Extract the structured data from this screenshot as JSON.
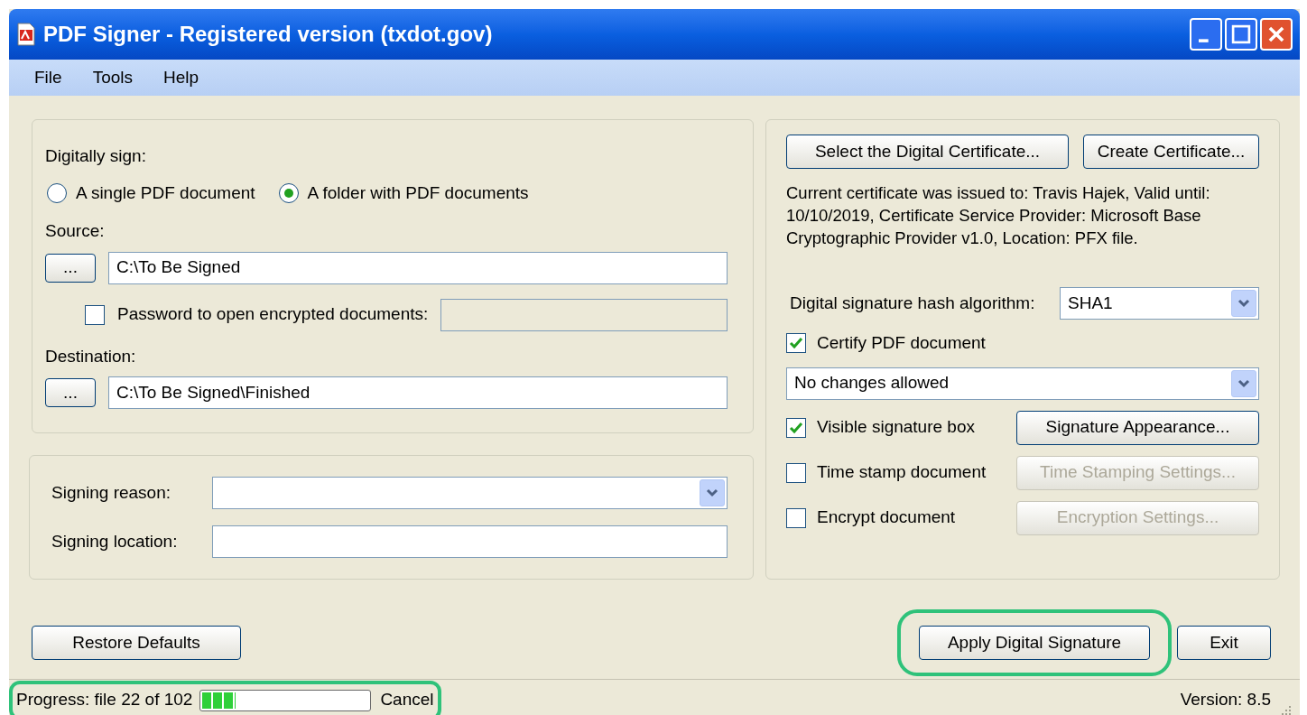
{
  "window": {
    "title": "PDF Signer - Registered version (txdot.gov)"
  },
  "menu": [
    "File",
    "Tools",
    "Help"
  ],
  "sign_panel": {
    "label": "Digitally sign:",
    "modes": [
      {
        "label": "A single PDF document",
        "selected": false
      },
      {
        "label": "A folder with PDF documents",
        "selected": true
      }
    ],
    "source": {
      "label": "Source:",
      "browse": "...",
      "value": "C:\\To Be Signed"
    },
    "password": {
      "label": "Password to open encrypted documents:",
      "checked": false,
      "disabled": true
    },
    "destination": {
      "label": "Destination:",
      "browse": "...",
      "value": "C:\\To Be Signed\\Finished"
    }
  },
  "reason_panel": {
    "reason": {
      "label": "Signing reason:"
    },
    "location": {
      "label": "Signing location:"
    }
  },
  "cert_panel": {
    "buttons": [
      "Select the Digital Certificate...",
      "Create Certificate..."
    ],
    "info": "Current certificate was issued to: Travis Hajek, Valid until: 10/10/2019, Certificate Service Provider: Microsoft Base Cryptographic Provider v1.0, Location: PFX file.",
    "hash": {
      "label": "Digital signature hash algorithm:",
      "value": "SHA1"
    },
    "options": [
      {
        "kind": "checkbox",
        "label": "Certify PDF document",
        "checked": true
      },
      {
        "kind": "dropdown",
        "value": "No changes allowed"
      },
      {
        "kind": "checkbox-button",
        "label": "Visible signature box",
        "checked": true,
        "button": "Signature Appearance...",
        "disabled": false
      },
      {
        "kind": "checkbox-button",
        "label": "Time stamp document",
        "checked": false,
        "button": "Time Stamping Settings...",
        "disabled": true
      },
      {
        "kind": "checkbox-button",
        "label": "Encrypt document",
        "checked": false,
        "button": "Encryption Settings...",
        "disabled": true
      }
    ]
  },
  "footer": {
    "restore": "Restore Defaults",
    "apply": {
      "label": "Apply Digital Signature",
      "highlighted": true
    },
    "exit": "Exit"
  },
  "status_bar": {
    "progress_text": "Progress: file 22 of 102",
    "level": 0.2,
    "cancel": "Cancel",
    "highlighted": true,
    "version": "Version: 8.5"
  }
}
